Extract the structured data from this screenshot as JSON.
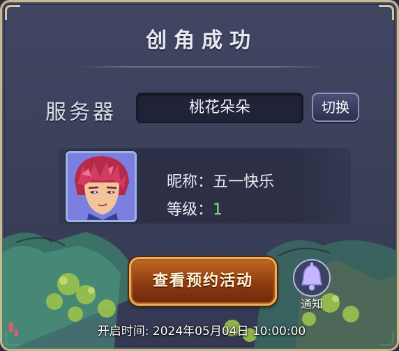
{
  "dialog": {
    "title": "创角成功"
  },
  "server": {
    "label": "服务器",
    "value": "桃花朵朵",
    "switch_label": "切换"
  },
  "character": {
    "nickname_label": "昵称：",
    "nickname": "五一快乐",
    "level_label": "等级：",
    "level": "1",
    "avatar_icon": "character-portrait-icon"
  },
  "actions": {
    "reserve_button": "查看预约活动",
    "notify_label": "通知",
    "notify_icon": "bell-icon"
  },
  "open_time": {
    "label": "开启时间: ",
    "value": "2024年05月04日 10:00:00"
  },
  "colors": {
    "level_value": "#7fe77a",
    "panel_border": "#c8b98e",
    "reserve_button": "#8e3a10"
  }
}
